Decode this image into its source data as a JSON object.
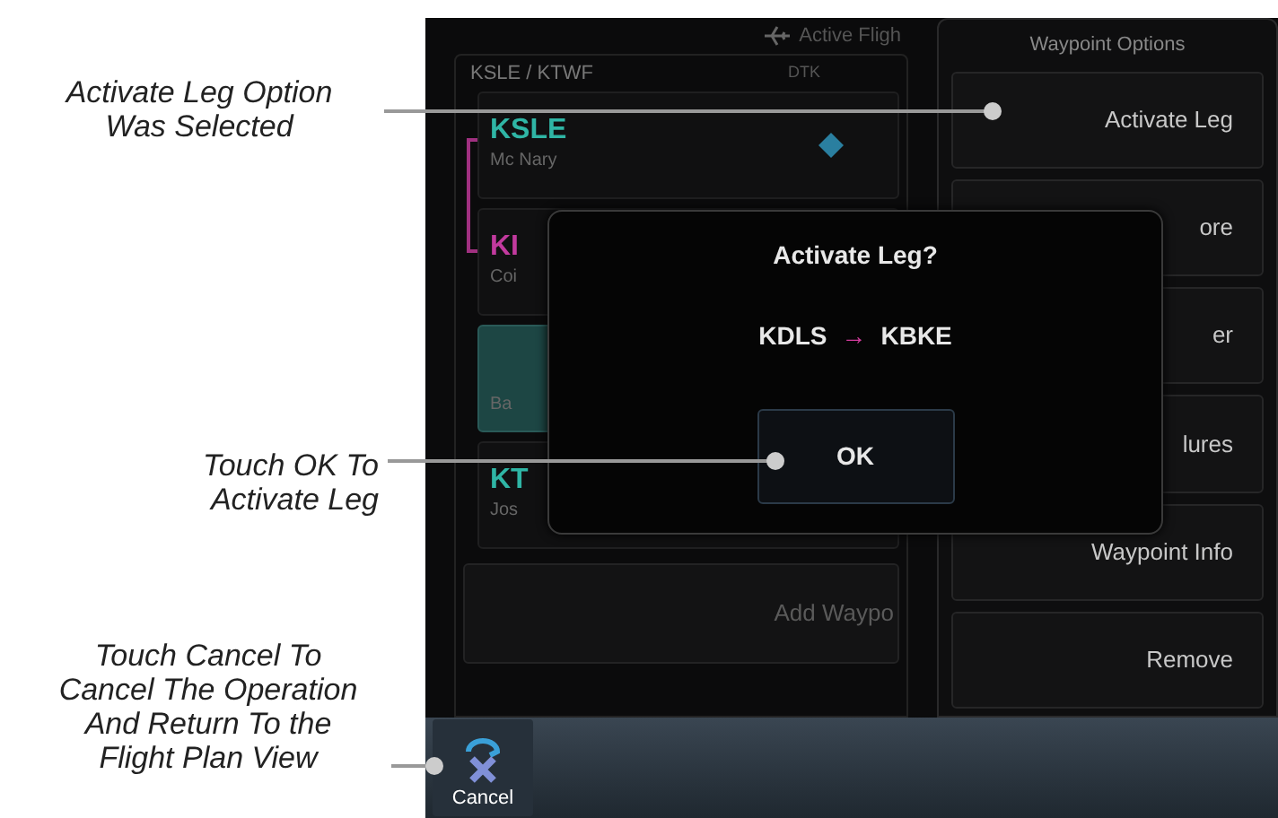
{
  "callouts": [
    {
      "lines": [
        "Activate Leg Option",
        "Was Selected"
      ]
    },
    {
      "lines": [
        "Touch OK To",
        "Activate Leg"
      ]
    },
    {
      "lines": [
        "Touch Cancel To",
        "Cancel The Operation",
        "And Return To the",
        "Flight Plan View"
      ]
    }
  ],
  "screen": {
    "title": "Active Fligh",
    "flight_plan": {
      "header": "KSLE / KTWF",
      "column": "DTK",
      "rows": [
        {
          "kind": "origin",
          "ident": "KSLE",
          "name": "Mc Nary",
          "color": "#2fb5a5",
          "selected": false
        },
        {
          "kind": "waypoint",
          "ident": "KI",
          "name": "Coi",
          "color": "#c23a9e",
          "selected": false
        },
        {
          "kind": "waypoint",
          "name": "Ba",
          "selected": true
        },
        {
          "kind": "waypoint",
          "ident": "KT",
          "name": "Jos",
          "color": "#2fb5a5",
          "selected": false
        }
      ],
      "add_button": "Add Waypo"
    },
    "options": {
      "title": "Waypoint Options",
      "buttons": [
        "Activate Leg",
        "ore",
        "er",
        "lures",
        "Waypoint Info",
        "Remove"
      ]
    },
    "dialog": {
      "title": "Activate Leg?",
      "from": "KDLS",
      "arrow": "→",
      "to": "KBKE",
      "ok": "OK"
    },
    "cancel": "Cancel"
  }
}
